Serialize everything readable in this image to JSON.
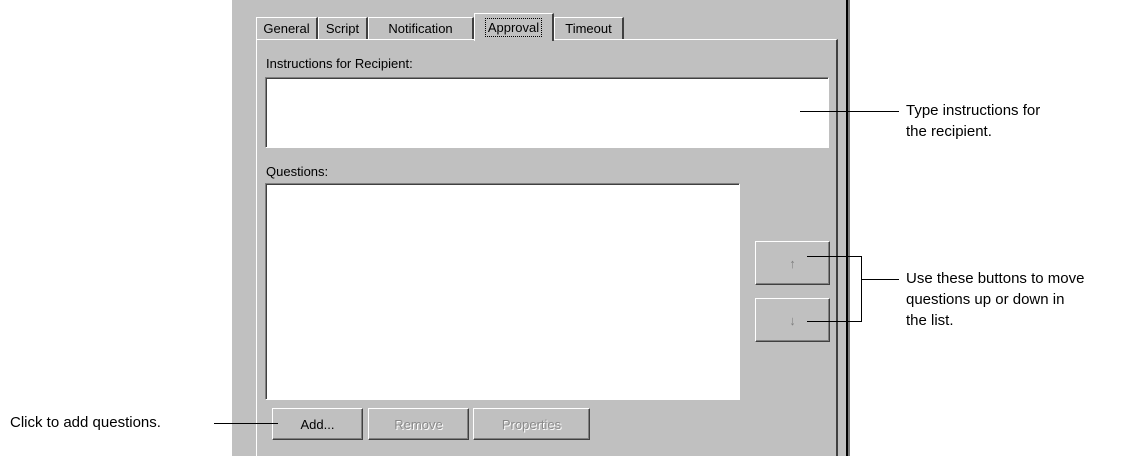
{
  "tabs": [
    {
      "label": "General",
      "selected": false
    },
    {
      "label": "Script",
      "selected": false
    },
    {
      "label": "Notification",
      "selected": false
    },
    {
      "label": "Approval",
      "selected": true
    },
    {
      "label": "Timeout",
      "selected": false
    }
  ],
  "instructions": {
    "label": "Instructions for Recipient:",
    "value": ""
  },
  "questions": {
    "label": "Questions:",
    "items": []
  },
  "buttons": {
    "add": "Add...",
    "remove": "Remove",
    "properties": "Properties",
    "move_up_icon": "arrow-up-icon",
    "move_down_icon": "arrow-down-icon"
  },
  "callouts": {
    "instructions_line1": "Type instructions for",
    "instructions_line2": "the recipient.",
    "move_line1": "Use these buttons to move",
    "move_line2": "questions up or down in",
    "move_line3": "the list.",
    "add": "Click to add questions."
  }
}
